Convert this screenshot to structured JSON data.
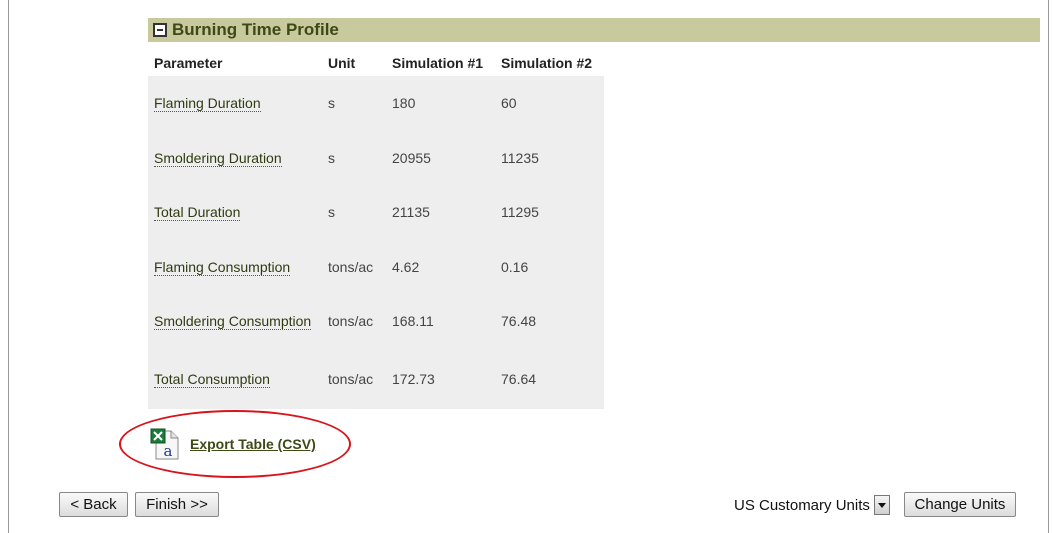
{
  "section": {
    "title": "Burning Time Profile"
  },
  "table": {
    "headers": [
      "Parameter",
      "Unit",
      "Simulation #1",
      "Simulation #2"
    ],
    "rows": [
      {
        "parameter": "Flaming Duration",
        "unit": "s",
        "sim1": "180",
        "sim2": "60"
      },
      {
        "parameter": "Smoldering Duration",
        "unit": "s",
        "sim1": "20955",
        "sim2": "11235"
      },
      {
        "parameter": "Total Duration",
        "unit": "s",
        "sim1": "21135",
        "sim2": "11295"
      },
      {
        "parameter": "Flaming Consumption",
        "unit": "tons/ac",
        "sim1": "4.62",
        "sim2": "0.16"
      },
      {
        "parameter": "Smoldering Consumption",
        "unit": "tons/ac",
        "sim1": "168.11",
        "sim2": "76.48"
      },
      {
        "parameter": "Total Consumption",
        "unit": "tons/ac",
        "sim1": "172.73",
        "sim2": "76.64"
      }
    ]
  },
  "export": {
    "label": "Export Table (CSV)",
    "icon": "excel-file-icon"
  },
  "footer": {
    "back_label": "< Back",
    "finish_label": "Finish >>",
    "units_selected": "US Customary Units",
    "change_units_label": "Change Units"
  },
  "colors": {
    "header_band": "#c9c99e",
    "title_text": "#3d4a16",
    "annotation_ellipse": "#d8141c"
  }
}
